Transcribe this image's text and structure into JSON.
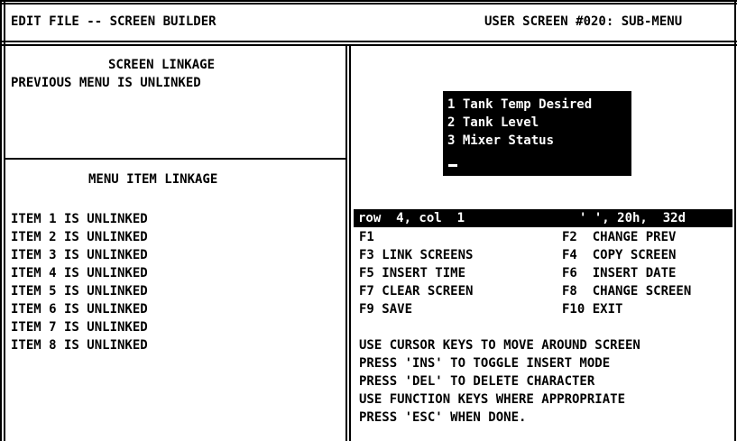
{
  "header": {
    "left_title": "EDIT FILE -- SCREEN BUILDER",
    "right_title": "USER SCREEN #020: SUB-MENU"
  },
  "screen_linkage": {
    "heading": "SCREEN LINKAGE",
    "status": "PREVIOUS MENU IS UNLINKED"
  },
  "menu_item_linkage": {
    "heading": "MENU ITEM LINKAGE",
    "items": [
      "ITEM 1 IS UNLINKED",
      "ITEM 2 IS UNLINKED",
      "ITEM 3 IS UNLINKED",
      "ITEM 4 IS UNLINKED",
      "ITEM 5 IS UNLINKED",
      "ITEM 6 IS UNLINKED",
      "ITEM 7 IS UNLINKED",
      "ITEM 8 IS UNLINKED"
    ]
  },
  "preview": {
    "lines": [
      "1 Tank Temp Desired",
      "2 Tank Level",
      "3 Mixer Status"
    ]
  },
  "status_bar": {
    "position": "row  4, col  1",
    "char_info": "' ', 20h,  32d"
  },
  "function_keys": [
    [
      "F1",
      ""
    ],
    [
      "F2",
      "CHANGE PREV"
    ],
    [
      "F3",
      "LINK SCREENS"
    ],
    [
      "F4",
      "COPY SCREEN"
    ],
    [
      "F5",
      "INSERT TIME"
    ],
    [
      "F6",
      "INSERT DATE"
    ],
    [
      "F7",
      "CLEAR SCREEN"
    ],
    [
      "F8",
      "CHANGE SCREEN"
    ],
    [
      "F9",
      "SAVE"
    ],
    [
      "F10",
      "EXIT"
    ]
  ],
  "instructions": [
    "USE CURSOR KEYS TO MOVE AROUND SCREEN",
    "PRESS 'INS' TO TOGGLE INSERT MODE",
    "PRESS 'DEL' TO DELETE CHARACTER",
    "USE FUNCTION KEYS WHERE APPROPRIATE",
    "PRESS 'ESC' WHEN DONE."
  ]
}
